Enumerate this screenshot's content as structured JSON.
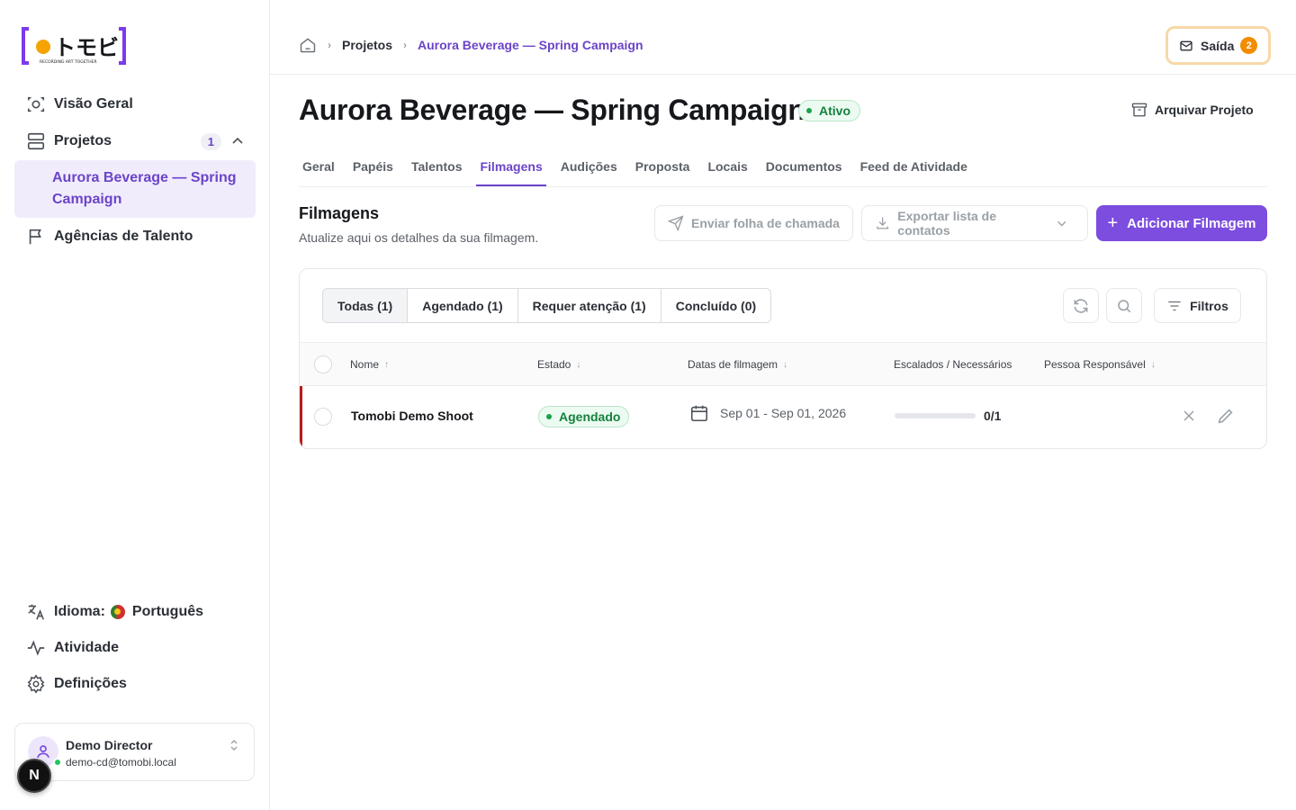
{
  "sidebar": {
    "logo_text": "トモビ",
    "logo_tagline": "RECORDING ART TOGETHER",
    "items": [
      {
        "label": "Visão Geral",
        "icon": "scan-icon"
      },
      {
        "label": "Projetos",
        "icon": "server-stack-icon",
        "badge": "1"
      },
      {
        "label": "Agências de Talento",
        "icon": "flag-icon"
      }
    ],
    "active_project": "Aurora Beverage — Spring Campaign",
    "language_label": "Idioma:",
    "language_value": "Português",
    "activity_label": "Atividade",
    "settings_label": "Definições",
    "user": {
      "name": "Demo Director",
      "email": "demo-cd@tomobi.local",
      "initial": "N"
    }
  },
  "header": {
    "breadcrumb": [
      "Projetos",
      "Aurora Beverage — Spring Campaign"
    ],
    "outbox_label": "Saída",
    "outbox_count": "2"
  },
  "project": {
    "title": "Aurora Beverage — Spring Campaign",
    "status": "Ativo",
    "archive_label": "Arquivar Projeto"
  },
  "tabs": [
    "Geral",
    "Papéis",
    "Talentos",
    "Filmagens",
    "Audições",
    "Proposta",
    "Locais",
    "Documentos",
    "Feed de Atividade"
  ],
  "active_tab": "Filmagens",
  "section": {
    "title": "Filmagens",
    "subtitle": "Atualize aqui os detalhes da sua filmagem.",
    "send_callsheet": "Enviar folha de chamada",
    "export_contacts": "Exportar lista de contatos",
    "add_shoot": "Adicionar Filmagem"
  },
  "filters": {
    "segments": [
      "Todas (1)",
      "Agendado (1)",
      "Requer atenção (1)",
      "Concluído (0)"
    ],
    "active_segment": 0,
    "filters_label": "Filtros"
  },
  "table": {
    "columns": [
      "Nome",
      "Estado",
      "Datas de filmagem",
      "Escalados / Necessários",
      "Pessoa Responsável"
    ],
    "rows": [
      {
        "name": "Tomobi Demo Shoot",
        "status": "Agendado",
        "dates": "Sep 01 - Sep 01, 2026",
        "cast_ratio": "0/1",
        "cast_progress": 0,
        "owner": ""
      }
    ]
  },
  "colors": {
    "accent": "#7c4ddf",
    "accent_text": "#6b44c8",
    "success": "#16a34a",
    "warning": "#f28c00",
    "row_flag": "#b91c1c"
  }
}
